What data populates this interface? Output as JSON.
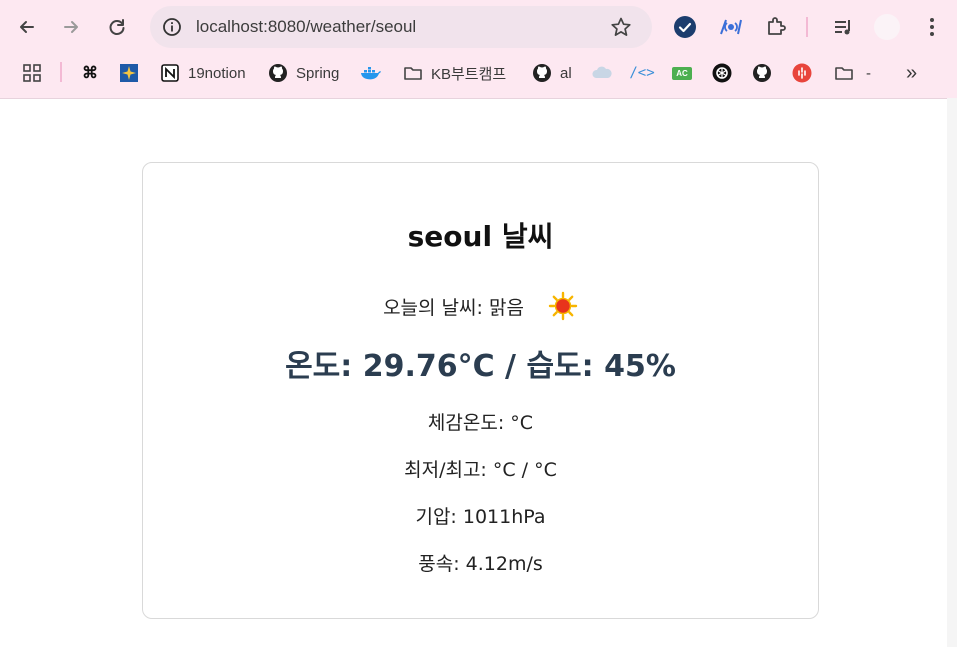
{
  "browser": {
    "url": "localhost:8080/weather/seoul",
    "toolbar_icons": [
      "back-arrow-icon",
      "forward-arrow-icon",
      "reload-icon",
      "site-info-icon",
      "star-icon",
      "extensions-icon",
      "media-icon",
      "profile-icon",
      "menu-icon"
    ],
    "bookmarks": [
      {
        "label": "",
        "icon": "apps-grid-icon"
      },
      {
        "label": "",
        "icon": "bookmark-icon"
      },
      {
        "label": "",
        "icon": "bookmark-icon"
      },
      {
        "label": "19notion",
        "icon": "notion-icon"
      },
      {
        "label": "Spring",
        "icon": "github-icon"
      },
      {
        "label": "",
        "icon": "docker-icon"
      },
      {
        "label": "KB부트캠프",
        "icon": "folder-icon"
      },
      {
        "label": "al",
        "icon": "github-icon"
      },
      {
        "label": "",
        "icon": "cloud-icon"
      },
      {
        "label": "",
        "icon": "code-icon"
      },
      {
        "label": "",
        "icon": "ac-icon"
      },
      {
        "label": "",
        "icon": "openai-icon"
      },
      {
        "label": "",
        "icon": "github-icon"
      },
      {
        "label": "",
        "icon": "red-circle-icon"
      },
      {
        "label": "-",
        "icon": "folder-icon"
      }
    ],
    "overflow_label": "»",
    "colors": {
      "chrome_bg": "#fde8f1",
      "omnibox_bg": "#f1e3ec"
    }
  },
  "weather": {
    "title": "seoul 날씨",
    "condition_text": "오늘의 날씨: 맑음",
    "condition_icon": "sun-icon",
    "main_line": "온도: 29.76°C / 습도: 45%",
    "feels_like": "체감온도: °C",
    "min_max": "최저/최고: °C / °C",
    "pressure": "기압: 1011hPa",
    "wind": "풍속: 4.12m/s",
    "accent_color": "#2b3d50"
  }
}
